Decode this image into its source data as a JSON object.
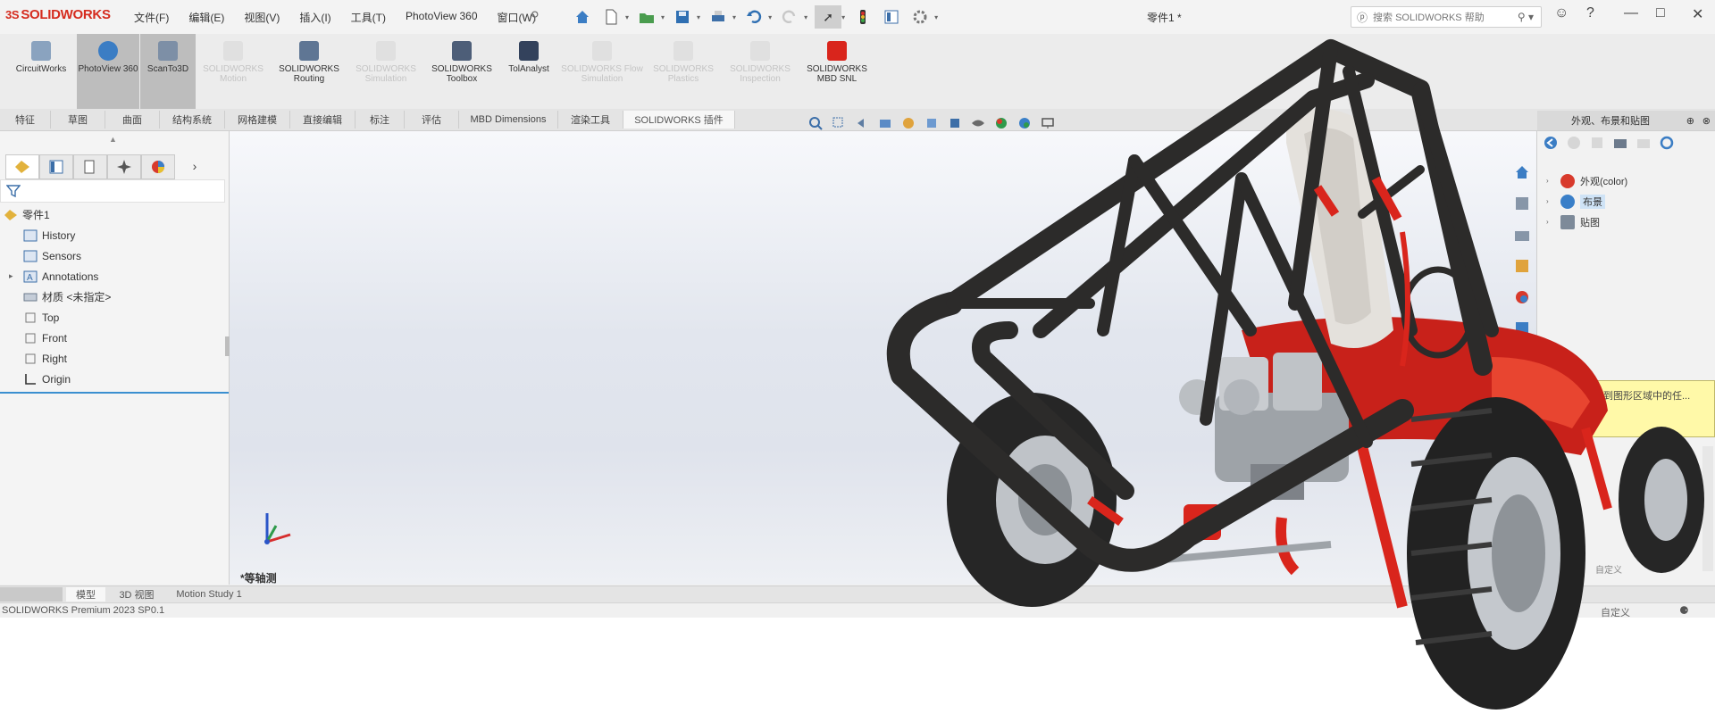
{
  "app": {
    "brand": "SOLIDWORKS",
    "brand_mark": "3S",
    "document_title": "零件1 *"
  },
  "menu": [
    "文件(F)",
    "编辑(E)",
    "视图(V)",
    "插入(I)",
    "工具(T)",
    "PhotoView 360",
    "窗口(W)"
  ],
  "search": {
    "placeholder": "搜索 SOLIDWORKS 帮助"
  },
  "command_manager": [
    {
      "label": "CircuitWorks",
      "state": "normal"
    },
    {
      "label": "PhotoView 360",
      "state": "active"
    },
    {
      "label": "ScanTo3D",
      "state": "active"
    },
    {
      "label": "SOLIDWORKS Motion",
      "state": "disabled"
    },
    {
      "label": "SOLIDWORKS Routing",
      "state": "normal"
    },
    {
      "label": "SOLIDWORKS Simulation",
      "state": "disabled"
    },
    {
      "label": "SOLIDWORKS Toolbox",
      "state": "normal"
    },
    {
      "label": "TolAnalyst",
      "state": "normal"
    },
    {
      "label": "SOLIDWORKS Flow Simulation",
      "state": "disabled"
    },
    {
      "label": "SOLIDWORKS Plastics",
      "state": "disabled"
    },
    {
      "label": "SOLIDWORKS Inspection",
      "state": "disabled"
    },
    {
      "label": "SOLIDWORKS MBD SNL",
      "state": "normal"
    }
  ],
  "tabs": [
    "特征",
    "草图",
    "曲面",
    "结构系统",
    "网格建模",
    "直接编辑",
    "标注",
    "评估",
    "MBD Dimensions",
    "渲染工具",
    "SOLIDWORKS 插件"
  ],
  "selected_tab": "SOLIDWORKS 插件",
  "feature_tree": [
    {
      "label": "零件1",
      "icon": "part-icon",
      "indent": 0,
      "expand": ""
    },
    {
      "label": "History",
      "icon": "history-icon",
      "indent": 1,
      "expand": ""
    },
    {
      "label": "Sensors",
      "icon": "sensors-icon",
      "indent": 1,
      "expand": ""
    },
    {
      "label": "Annotations",
      "icon": "annotations-icon",
      "indent": 1,
      "expand": "▸"
    },
    {
      "label": "材质 <未指定>",
      "icon": "material-icon",
      "indent": 1,
      "expand": ""
    },
    {
      "label": "Top",
      "icon": "plane-icon",
      "indent": 1,
      "expand": ""
    },
    {
      "label": "Front",
      "icon": "plane-icon",
      "indent": 1,
      "expand": ""
    },
    {
      "label": "Right",
      "icon": "plane-icon",
      "indent": 1,
      "expand": ""
    },
    {
      "label": "Origin",
      "icon": "origin-icon",
      "indent": 1,
      "expand": ""
    }
  ],
  "viewport": {
    "view_label": "*等轴测"
  },
  "task_pane": {
    "title": "外观、布景和贴图",
    "tree": [
      {
        "label": "外观(color)",
        "icon": "appearance-icon",
        "color": "#d83a2c"
      },
      {
        "label": "布景",
        "icon": "scene-icon",
        "color": "#3a7fc8"
      },
      {
        "label": "贴图",
        "icon": "decal-icon",
        "color": "#7d8a99"
      }
    ],
    "selected": "布景"
  },
  "tooltip": {
    "text": "拖动到图形区域中的任..."
  },
  "custom_label": "自定义",
  "bottom_tabs": [
    "模型",
    "3D 视图",
    "Motion Study 1"
  ],
  "selected_bottom_tab": "模型",
  "status": {
    "text": "SOLIDWORKS Premium 2023 SP0.1",
    "right": "自定义"
  },
  "colors": {
    "brand": "#d52b1e",
    "selection": "#3a8fd0",
    "accent_red": "#d9251c",
    "frame": "#2c2b2a"
  }
}
